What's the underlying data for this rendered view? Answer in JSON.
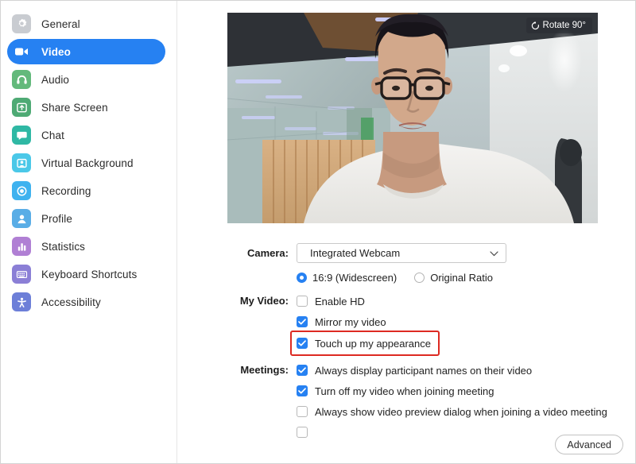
{
  "sidebar": {
    "items": [
      {
        "label": "General",
        "icon": "gear-icon",
        "color": "#c9ccd1",
        "active": false
      },
      {
        "label": "Video",
        "icon": "camera-icon",
        "color": "#2681F2",
        "active": true
      },
      {
        "label": "Audio",
        "icon": "headset-icon",
        "color": "#63b97b",
        "active": false
      },
      {
        "label": "Share Screen",
        "icon": "share-screen-icon",
        "color": "#4eaa74",
        "active": false
      },
      {
        "label": "Chat",
        "icon": "chat-bubble-icon",
        "color": "#2fb8a4",
        "active": false
      },
      {
        "label": "Virtual Background",
        "icon": "virtual-background-icon",
        "color": "#4bc8e8",
        "active": false
      },
      {
        "label": "Recording",
        "icon": "recording-icon",
        "color": "#3fb2ef",
        "active": false
      },
      {
        "label": "Profile",
        "icon": "profile-icon",
        "color": "#59ade6",
        "active": false
      },
      {
        "label": "Statistics",
        "icon": "statistics-icon",
        "color": "#b07fd4",
        "active": false
      },
      {
        "label": "Keyboard Shortcuts",
        "icon": "keyboard-icon",
        "color": "#8b7fd6",
        "active": false
      },
      {
        "label": "Accessibility",
        "icon": "accessibility-icon",
        "color": "#6d7fd8",
        "active": false
      }
    ]
  },
  "preview": {
    "rotate_button_label": "Rotate 90°",
    "rotate_icon": "rotate-icon"
  },
  "form": {
    "camera": {
      "label": "Camera:",
      "selected_device": "Integrated Webcam",
      "chevron_icon": "chevron-down-icon",
      "ratio_options": [
        {
          "label": "16:9 (Widescreen)",
          "checked": true
        },
        {
          "label": "Original Ratio",
          "checked": false
        }
      ]
    },
    "my_video": {
      "label": "My Video:",
      "options": [
        {
          "label": "Enable HD",
          "checked": false,
          "highlighted": false
        },
        {
          "label": "Mirror my video",
          "checked": true,
          "highlighted": false
        },
        {
          "label": "Touch up my appearance",
          "checked": true,
          "highlighted": true
        }
      ]
    },
    "meetings": {
      "label": "Meetings:",
      "options": [
        {
          "label": "Always display participant names on their video",
          "checked": true
        },
        {
          "label": "Turn off my video when joining meeting",
          "checked": true
        },
        {
          "label": "Always show video preview dialog when joining a video meeting",
          "checked": false
        }
      ]
    }
  },
  "footer": {
    "advanced_label": "Advanced"
  },
  "colors": {
    "accent": "#2681F2",
    "highlight": "#DD2A22"
  }
}
